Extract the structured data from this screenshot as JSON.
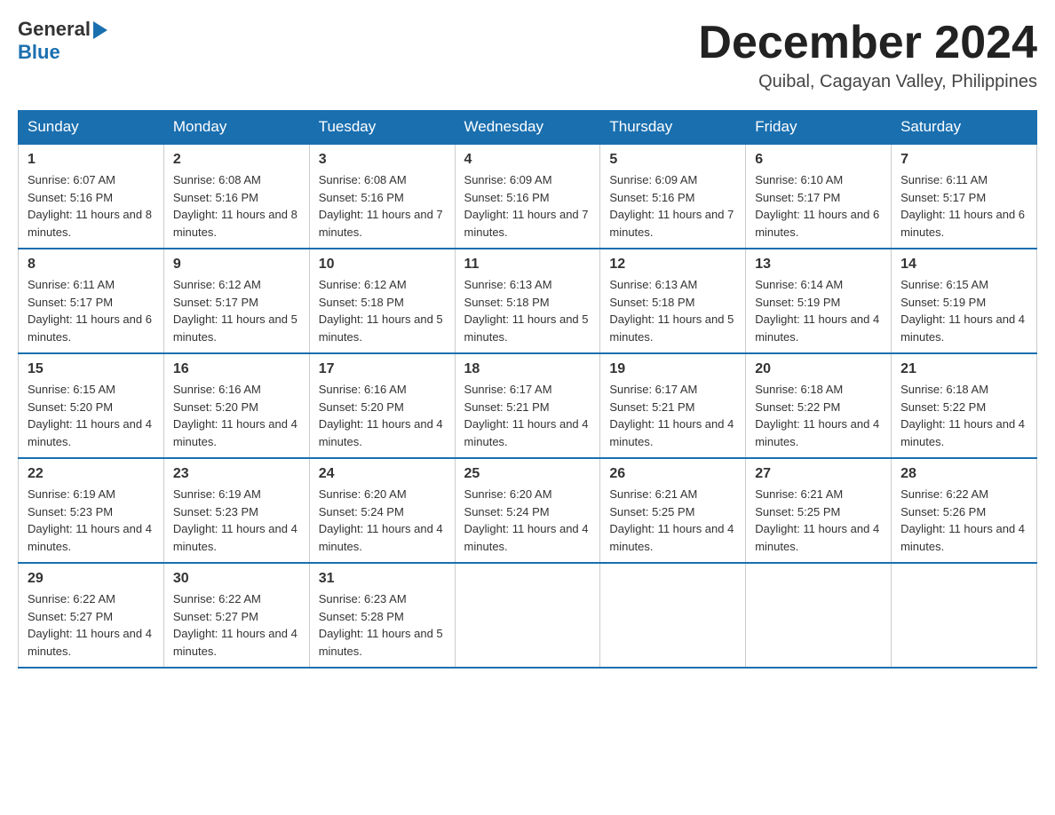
{
  "header": {
    "logo_general": "General",
    "logo_blue": "Blue",
    "month_title": "December 2024",
    "location": "Quibal, Cagayan Valley, Philippines"
  },
  "weekdays": [
    "Sunday",
    "Monday",
    "Tuesday",
    "Wednesday",
    "Thursday",
    "Friday",
    "Saturday"
  ],
  "weeks": [
    [
      {
        "day": "1",
        "sunrise": "6:07 AM",
        "sunset": "5:16 PM",
        "daylight": "11 hours and 8 minutes."
      },
      {
        "day": "2",
        "sunrise": "6:08 AM",
        "sunset": "5:16 PM",
        "daylight": "11 hours and 8 minutes."
      },
      {
        "day": "3",
        "sunrise": "6:08 AM",
        "sunset": "5:16 PM",
        "daylight": "11 hours and 7 minutes."
      },
      {
        "day": "4",
        "sunrise": "6:09 AM",
        "sunset": "5:16 PM",
        "daylight": "11 hours and 7 minutes."
      },
      {
        "day": "5",
        "sunrise": "6:09 AM",
        "sunset": "5:16 PM",
        "daylight": "11 hours and 7 minutes."
      },
      {
        "day": "6",
        "sunrise": "6:10 AM",
        "sunset": "5:17 PM",
        "daylight": "11 hours and 6 minutes."
      },
      {
        "day": "7",
        "sunrise": "6:11 AM",
        "sunset": "5:17 PM",
        "daylight": "11 hours and 6 minutes."
      }
    ],
    [
      {
        "day": "8",
        "sunrise": "6:11 AM",
        "sunset": "5:17 PM",
        "daylight": "11 hours and 6 minutes."
      },
      {
        "day": "9",
        "sunrise": "6:12 AM",
        "sunset": "5:17 PM",
        "daylight": "11 hours and 5 minutes."
      },
      {
        "day": "10",
        "sunrise": "6:12 AM",
        "sunset": "5:18 PM",
        "daylight": "11 hours and 5 minutes."
      },
      {
        "day": "11",
        "sunrise": "6:13 AM",
        "sunset": "5:18 PM",
        "daylight": "11 hours and 5 minutes."
      },
      {
        "day": "12",
        "sunrise": "6:13 AM",
        "sunset": "5:18 PM",
        "daylight": "11 hours and 5 minutes."
      },
      {
        "day": "13",
        "sunrise": "6:14 AM",
        "sunset": "5:19 PM",
        "daylight": "11 hours and 4 minutes."
      },
      {
        "day": "14",
        "sunrise": "6:15 AM",
        "sunset": "5:19 PM",
        "daylight": "11 hours and 4 minutes."
      }
    ],
    [
      {
        "day": "15",
        "sunrise": "6:15 AM",
        "sunset": "5:20 PM",
        "daylight": "11 hours and 4 minutes."
      },
      {
        "day": "16",
        "sunrise": "6:16 AM",
        "sunset": "5:20 PM",
        "daylight": "11 hours and 4 minutes."
      },
      {
        "day": "17",
        "sunrise": "6:16 AM",
        "sunset": "5:20 PM",
        "daylight": "11 hours and 4 minutes."
      },
      {
        "day": "18",
        "sunrise": "6:17 AM",
        "sunset": "5:21 PM",
        "daylight": "11 hours and 4 minutes."
      },
      {
        "day": "19",
        "sunrise": "6:17 AM",
        "sunset": "5:21 PM",
        "daylight": "11 hours and 4 minutes."
      },
      {
        "day": "20",
        "sunrise": "6:18 AM",
        "sunset": "5:22 PM",
        "daylight": "11 hours and 4 minutes."
      },
      {
        "day": "21",
        "sunrise": "6:18 AM",
        "sunset": "5:22 PM",
        "daylight": "11 hours and 4 minutes."
      }
    ],
    [
      {
        "day": "22",
        "sunrise": "6:19 AM",
        "sunset": "5:23 PM",
        "daylight": "11 hours and 4 minutes."
      },
      {
        "day": "23",
        "sunrise": "6:19 AM",
        "sunset": "5:23 PM",
        "daylight": "11 hours and 4 minutes."
      },
      {
        "day": "24",
        "sunrise": "6:20 AM",
        "sunset": "5:24 PM",
        "daylight": "11 hours and 4 minutes."
      },
      {
        "day": "25",
        "sunrise": "6:20 AM",
        "sunset": "5:24 PM",
        "daylight": "11 hours and 4 minutes."
      },
      {
        "day": "26",
        "sunrise": "6:21 AM",
        "sunset": "5:25 PM",
        "daylight": "11 hours and 4 minutes."
      },
      {
        "day": "27",
        "sunrise": "6:21 AM",
        "sunset": "5:25 PM",
        "daylight": "11 hours and 4 minutes."
      },
      {
        "day": "28",
        "sunrise": "6:22 AM",
        "sunset": "5:26 PM",
        "daylight": "11 hours and 4 minutes."
      }
    ],
    [
      {
        "day": "29",
        "sunrise": "6:22 AM",
        "sunset": "5:27 PM",
        "daylight": "11 hours and 4 minutes."
      },
      {
        "day": "30",
        "sunrise": "6:22 AM",
        "sunset": "5:27 PM",
        "daylight": "11 hours and 4 minutes."
      },
      {
        "day": "31",
        "sunrise": "6:23 AM",
        "sunset": "5:28 PM",
        "daylight": "11 hours and 5 minutes."
      },
      null,
      null,
      null,
      null
    ]
  ],
  "labels": {
    "sunrise": "Sunrise: ",
    "sunset": "Sunset: ",
    "daylight": "Daylight: "
  }
}
